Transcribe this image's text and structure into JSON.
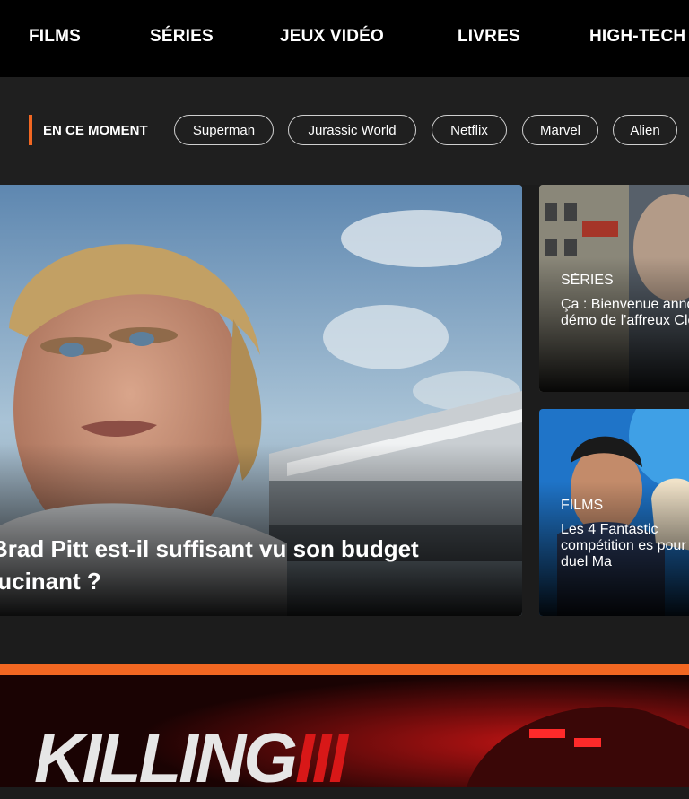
{
  "nav": {
    "items": [
      "FILMS",
      "SÉRIES",
      "JEUX VIDÉO",
      "LIVRES",
      "HIGH-TECH"
    ]
  },
  "trending": {
    "label": "EN CE MOMENT",
    "pills": [
      "Superman",
      "Jurassic World",
      "Netflix",
      "Marvel",
      "Alien"
    ]
  },
  "hero": {
    "title_line1": "Brad Pitt est-il suffisant vu son budget",
    "title_line2": "lucinant ?"
  },
  "side_cards": [
    {
      "category": "SÉRIES",
      "title_lines": [
        "Ça : Bienvenue",
        "annonce démo",
        "de l'affreux Clo"
      ]
    },
    {
      "category": "FILMS",
      "title_lines": [
        "Les 4 Fantastic",
        "compétition es",
        "pour le duel Ma"
      ]
    }
  ],
  "promo": {
    "text": "KILLING",
    "num": "III"
  },
  "colors": {
    "accent": "#f26722",
    "nav_bg": "#000000",
    "page_bg": "#1c1c1c"
  }
}
